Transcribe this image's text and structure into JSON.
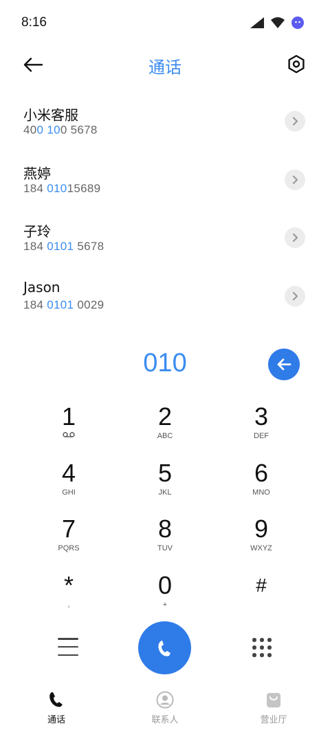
{
  "status": {
    "time": "8:16"
  },
  "header": {
    "title": "通话",
    "back_icon": "arrow-left-icon",
    "settings_icon": "hexagon-settings-icon"
  },
  "contacts": [
    {
      "name": "小米客服",
      "number_parts": [
        "40",
        "0",
        " ",
        "10",
        "0 5678"
      ]
    },
    {
      "name": "燕婷",
      "number_parts": [
        "184 ",
        "010",
        "15689"
      ]
    },
    {
      "name": "子玲",
      "number_parts": [
        "184 ",
        "0101",
        " 5678"
      ]
    },
    {
      "name": "Jason",
      "number_parts": [
        "184 ",
        "0101",
        " 0029"
      ]
    }
  ],
  "dial": {
    "input": "010"
  },
  "keypad": [
    {
      "digit": "1",
      "sub": "voicemail"
    },
    {
      "digit": "2",
      "sub": "ABC"
    },
    {
      "digit": "3",
      "sub": "DEF"
    },
    {
      "digit": "4",
      "sub": "GHI"
    },
    {
      "digit": "5",
      "sub": "JKL"
    },
    {
      "digit": "6",
      "sub": "MNO"
    },
    {
      "digit": "7",
      "sub": "PQRS"
    },
    {
      "digit": "8",
      "sub": "TUV"
    },
    {
      "digit": "9",
      "sub": "WXYZ"
    },
    {
      "digit": "*",
      "sub": ","
    },
    {
      "digit": "0",
      "sub": "+"
    },
    {
      "digit": "#",
      "sub": ""
    }
  ],
  "bottom_nav": [
    {
      "label": "通话",
      "icon": "phone-icon",
      "active": true
    },
    {
      "label": "联系人",
      "icon": "contacts-icon",
      "active": false
    },
    {
      "label": "营业厅",
      "icon": "store-bag-icon",
      "active": false
    }
  ],
  "colors": {
    "accent": "#3b8cf0",
    "call_button": "#2f7be8"
  }
}
